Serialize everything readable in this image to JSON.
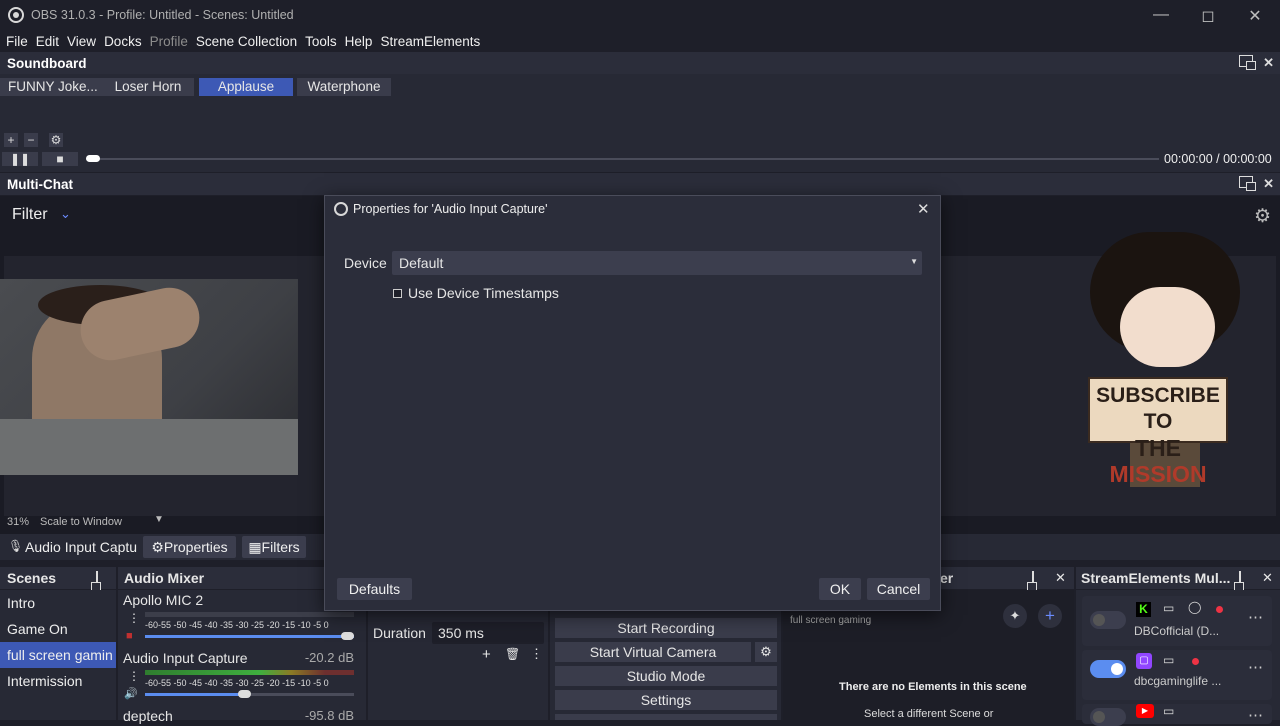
{
  "window": {
    "title": "OBS 31.0.3 - Profile: Untitled - Scenes: Untitled"
  },
  "menu": [
    "File",
    "Edit",
    "View",
    "Docks",
    "Profile",
    "Scene Collection",
    "Tools",
    "Help",
    "StreamElements"
  ],
  "soundboard": {
    "title": "Soundboard",
    "buttons": [
      "FUNNY Joke...",
      "Loser Horn",
      "Applause",
      "Waterphone"
    ],
    "active": "Applause",
    "time": "00:00:00 / 00:00:00"
  },
  "multichat": {
    "title": "Multi-Chat",
    "filter_label": "Filter"
  },
  "overlay": {
    "line1": "SUBSCRIBE TO",
    "line2_a": "THE",
    "line2_b": "MISSION"
  },
  "preview": {
    "zoom": "31%",
    "scale_mode": "Scale to Window"
  },
  "source_bar": {
    "source": "Audio Input Captu",
    "properties": "Properties",
    "filters": "Filters"
  },
  "dialog": {
    "title": "Properties for 'Audio Input Capture'",
    "device_label": "Device",
    "device_value": "Default",
    "checkbox_label": "Use Device Timestamps",
    "defaults_btn": "Defaults",
    "ok_btn": "OK",
    "cancel_btn": "Cancel"
  },
  "scenes": {
    "title": "Scenes",
    "items": [
      "Intro",
      "Game On",
      "full screen gamin",
      "Intermission"
    ],
    "selected": 2
  },
  "mixer": {
    "title": "Audio Mixer",
    "scale": "-60-55 -50 -45 -40 -35 -30 -25 -20 -15 -10  -5   0",
    "channels": [
      {
        "name": "Apollo MIC 2",
        "db": "0"
      },
      {
        "name": "Audio Input Capture",
        "db": "-20.2 dB"
      },
      {
        "name": "deptech",
        "db": "-95.8 dB"
      }
    ]
  },
  "transitions": {
    "duration_label": "Duration",
    "duration_value": "350 ms"
  },
  "controls": {
    "start_recording": "Start Recording",
    "start_virtual_camera": "Start Virtual Camera",
    "studio_mode": "Studio Mode",
    "settings": "Settings"
  },
  "scene_elements": {
    "title_fragment": "er",
    "scene_name": "full screen gaming",
    "empty_msg": "There are no Elements in this scene",
    "hint": "Select a different Scene or"
  },
  "se_multi": {
    "title": "StreamElements Mul...",
    "accounts": [
      {
        "name": "DBCofficial (D...",
        "platform": "kick",
        "enabled": false,
        "color": "#53fc18"
      },
      {
        "name": "dbcgaminglife ...",
        "platform": "twitch",
        "enabled": true,
        "color": "#9146ff"
      },
      {
        "name": "",
        "platform": "youtube",
        "enabled": false,
        "color": "#ff0000"
      }
    ]
  },
  "colors": {
    "accent": "#3d59b5",
    "bg": "#1e1f29",
    "panel": "#272935"
  }
}
